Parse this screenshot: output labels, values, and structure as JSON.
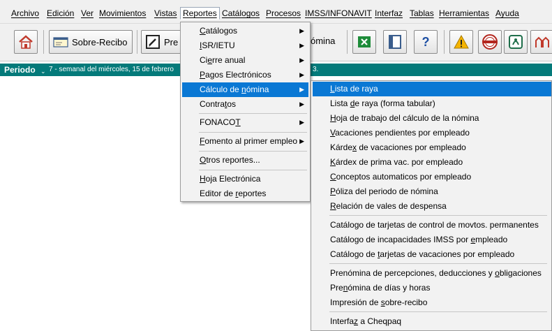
{
  "menubar": {
    "items": [
      "Archivo",
      "Edición",
      "Ver",
      "Movimientos",
      "Vistas",
      "Reportes",
      "Catálogos",
      "Procesos",
      "IMSS/INFONAVIT",
      "Interfaz",
      "Tablas",
      "Herramientas",
      "Ayuda"
    ],
    "active": "Reportes"
  },
  "toolbar": {
    "sobre_recibo_label": "Sobre-Recibo",
    "prenomina_label": "Pre",
    "nomina_label": "ómina"
  },
  "period": {
    "label": "Periodo",
    "text": "7 - semanal del miércoles, 15 de febrero",
    "end": "3."
  },
  "reportes_menu": {
    "items": [
      {
        "pre": "",
        "u": "C",
        "post": "atálogos",
        "submenu": true
      },
      {
        "pre": "",
        "u": "I",
        "post": "SR/IETU",
        "submenu": true
      },
      {
        "pre": "Ci",
        "u": "e",
        "post": "rre anual",
        "submenu": true
      },
      {
        "pre": "",
        "u": "P",
        "post": "agos Electrónicos",
        "submenu": true
      },
      {
        "pre": "Cálculo de ",
        "u": "n",
        "post": "ómina",
        "submenu": true
      },
      {
        "pre": "Contra",
        "u": "t",
        "post": "os",
        "submenu": true
      },
      {
        "pre": "FONACO",
        "u": "T",
        "post": "",
        "submenu": true
      },
      {
        "pre": "",
        "u": "F",
        "post": "omento al primer empleo",
        "submenu": true
      },
      {
        "pre": "",
        "u": "O",
        "post": "tros reportes...",
        "submenu": false
      },
      {
        "pre": "",
        "u": "H",
        "post": "oja Electrónica",
        "submenu": false
      },
      {
        "pre": "Editor de ",
        "u": "r",
        "post": "eportes",
        "submenu": false
      }
    ]
  },
  "calculo_menu": {
    "items": [
      {
        "pre": "",
        "u": "L",
        "post": "ista de raya"
      },
      {
        "pre": "Lista ",
        "u": "d",
        "post": "e raya (forma tabular)"
      },
      {
        "pre": "",
        "u": "H",
        "post": "oja de trabajo del cálculo de la nómina"
      },
      {
        "pre": "",
        "u": "V",
        "post": "acaciones pendientes por empleado"
      },
      {
        "pre": "Kárde",
        "u": "x",
        "post": " de vacaciones por empleado"
      },
      {
        "pre": "",
        "u": "K",
        "post": "árdex de prima vac. por empleado"
      },
      {
        "pre": "",
        "u": "C",
        "post": "onceptos automaticos por empleado"
      },
      {
        "pre": "",
        "u": "P",
        "post": "óliza del periodo de nómina"
      },
      {
        "pre": "",
        "u": "R",
        "post": "elación de vales de despensa"
      },
      {
        "pre": "Catálogo de tarjetas de control de movtos. permanentes",
        "u": "",
        "post": ""
      },
      {
        "pre": "Catálogo de incapacidades IMSS por ",
        "u": "e",
        "post": "mpleado"
      },
      {
        "pre": "Catálogo de ",
        "u": "t",
        "post": "arjetas de vacaciones por empleado"
      },
      {
        "pre": "Prenómina de percepciones, deducciones y ",
        "u": "o",
        "post": "bligaciones"
      },
      {
        "pre": "Pre",
        "u": "n",
        "post": "ómina de días y horas"
      },
      {
        "pre": "Impresión de ",
        "u": "s",
        "post": "obre-recibo"
      },
      {
        "pre": "Interfa",
        "u": "z",
        "post": " a Cheqpaq"
      }
    ]
  },
  "colors": {
    "period_bar": "#047a7a",
    "menu_highlight": "#0a78d4"
  }
}
